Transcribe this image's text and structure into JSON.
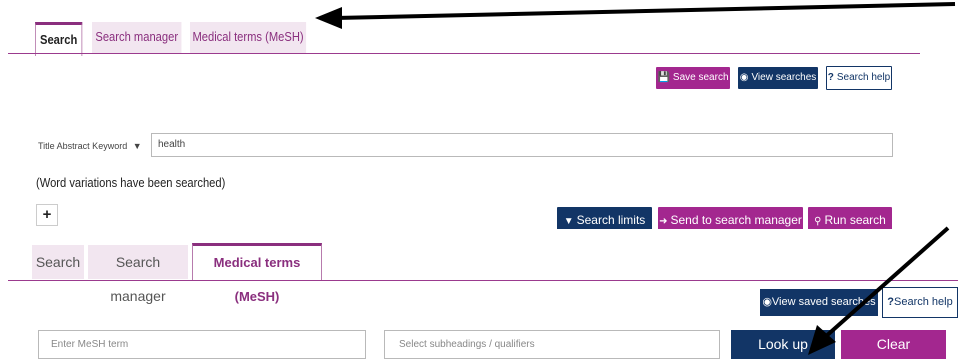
{
  "top_panel": {
    "tabs": [
      {
        "label": "Search",
        "active": true
      },
      {
        "label": "Search manager",
        "active": false
      },
      {
        "label": "Medical terms (MeSH)",
        "active": false
      }
    ],
    "actions": {
      "save_search": "Save search",
      "view_searches": "View searches",
      "search_help": "Search help"
    },
    "field_select": "Title Abstract Keyword",
    "query_value": "health",
    "word_variations_note": "(Word variations have been searched)",
    "add_row_symbol": "+",
    "bottom_actions": {
      "search_limits": "Search limits",
      "send_to_manager": "Send to search manager",
      "run_search": "Run search"
    }
  },
  "bottom_panel": {
    "tabs": [
      {
        "label": "Search",
        "active": false
      },
      {
        "label": "Search manager",
        "active": false
      },
      {
        "label": "Medical terms (MeSH)",
        "active": true
      }
    ],
    "actions": {
      "view_saved_searches": "View saved searches",
      "search_help": "Search help"
    },
    "mesh_placeholder": "Enter MeSH term",
    "subheadings_placeholder": "Select subheadings / qualifiers",
    "look_up": "Look up",
    "clear": "Clear"
  },
  "colors": {
    "brand_purple": "#a3278f",
    "navy": "#123566",
    "tab_bg": "#f2e6f0"
  }
}
